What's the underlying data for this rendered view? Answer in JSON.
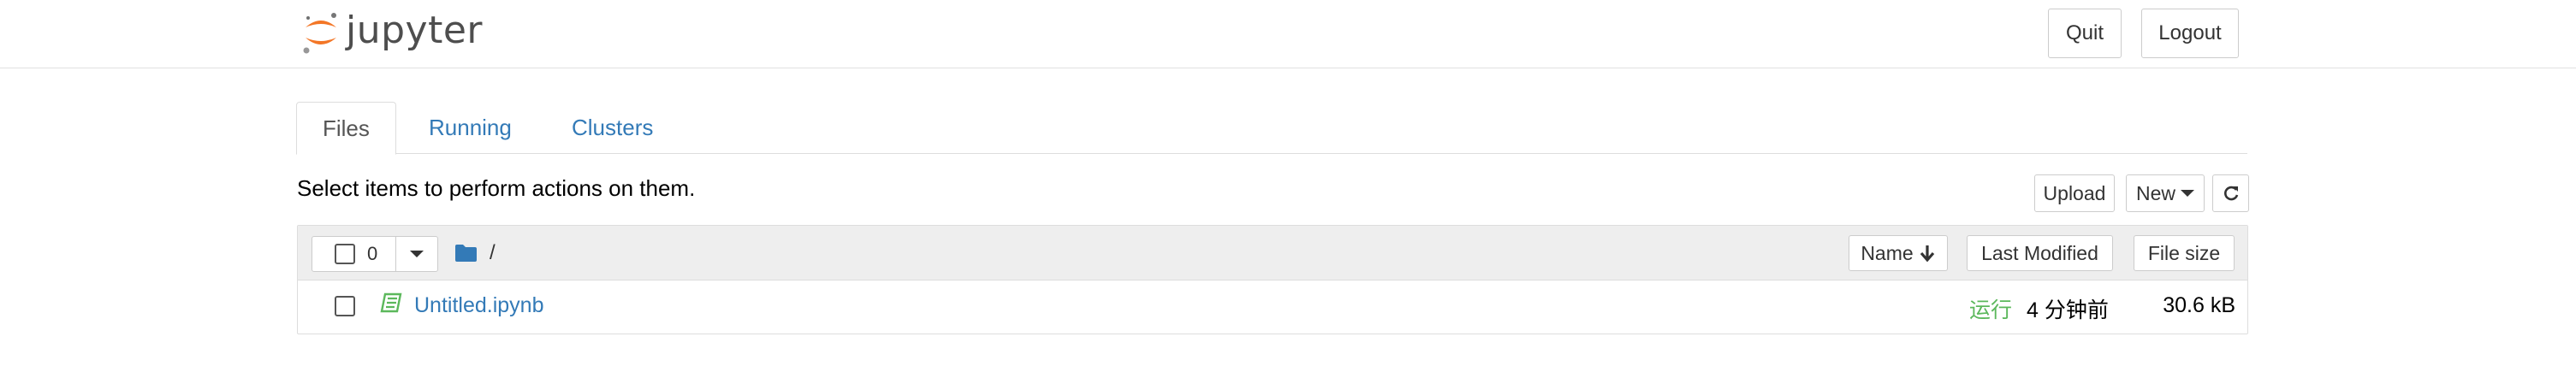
{
  "header": {
    "logo_text": "jupyter",
    "quit_label": "Quit",
    "logout_label": "Logout"
  },
  "tabs": [
    {
      "label": "Files",
      "active": true
    },
    {
      "label": "Running",
      "active": false
    },
    {
      "label": "Clusters",
      "active": false
    }
  ],
  "toolbar": {
    "select_text": "Select items to perform actions on them.",
    "upload_label": "Upload",
    "new_label": "New",
    "refresh_icon": "refresh-icon"
  },
  "list_header": {
    "selected_count": "0",
    "breadcrumb_sep": "/",
    "name_label": "Name",
    "last_modified_label": "Last Modified",
    "file_size_label": "File size"
  },
  "files": [
    {
      "name": "Untitled.ipynb",
      "status": "运行",
      "modified": "4 分钟前",
      "size": "30.6 kB"
    }
  ],
  "colors": {
    "link": "#337ab7",
    "running": "#5cb85c",
    "logo_orange": "#f37626",
    "folder": "#337ab7"
  }
}
